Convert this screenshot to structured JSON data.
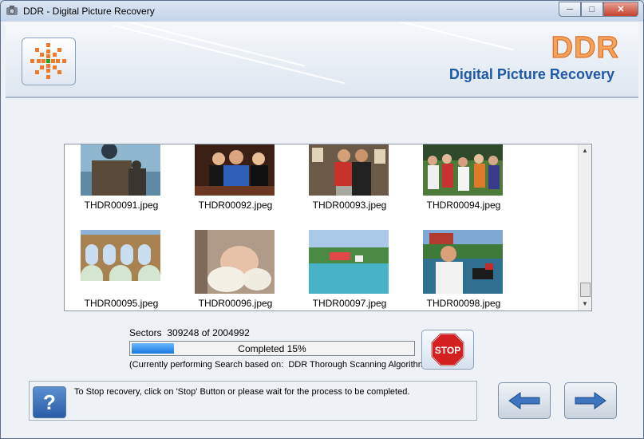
{
  "window": {
    "title": "DDR - Digital Picture Recovery"
  },
  "banner": {
    "brand": "DDR",
    "subtitle": "Digital Picture Recovery"
  },
  "thumbnails": [
    {
      "name": "THDR00091.jpeg",
      "theme": "seaside-chairs"
    },
    {
      "name": "THDR00092.jpeg",
      "theme": "friends-bar"
    },
    {
      "name": "THDR00093.jpeg",
      "theme": "men-indoor"
    },
    {
      "name": "THDR00094.jpeg",
      "theme": "group-outdoor"
    },
    {
      "name": "THDR00095.jpeg",
      "theme": "aqueduct"
    },
    {
      "name": "THDR00096.jpeg",
      "theme": "baby"
    },
    {
      "name": "THDR00097.jpeg",
      "theme": "harbor"
    },
    {
      "name": "THDR00098.jpeg",
      "theme": "man-boat"
    }
  ],
  "scan": {
    "sectors_text": "Sectors  309248 of 2004992",
    "progress_label": "Completed 15%",
    "progress_percent": 15,
    "algorithm_text": "(Currently performing Search based on:  DDR Thorough Scanning Algorithm)"
  },
  "buttons": {
    "stop_label": "STOP",
    "help_label": "?"
  },
  "info": {
    "message": "To Stop recovery, click on 'Stop' Button or please wait for the process to be completed."
  },
  "colors": {
    "brand_orange": "#f7a25a",
    "brand_blue": "#1f59a8",
    "progress_blue": "#1a7ae0",
    "stop_red": "#d42020"
  },
  "icons": {
    "app": "camera-icon",
    "logo": "snowflake-logo",
    "back": "arrow-left-icon",
    "next": "arrow-right-icon",
    "stop": "stop-sign-icon",
    "help": "help-icon"
  }
}
